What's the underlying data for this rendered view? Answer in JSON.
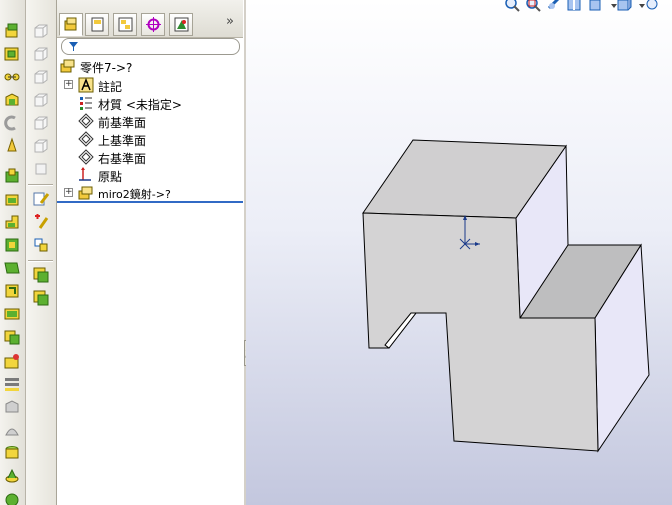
{
  "feature_manager": {
    "tabs": [
      "feature-manager-tab",
      "property-manager-tab",
      "configuration-manager-tab",
      "dimxpert-tab",
      "display-manager-tab"
    ],
    "expand_glyph": "»",
    "filter_icon": "filter-icon",
    "tree": [
      {
        "label": "零件7->?",
        "icon": "part-icon",
        "level": 0
      },
      {
        "label": "註記",
        "icon": "annotations-icon",
        "level": 1,
        "expandable": true
      },
      {
        "label": "材質 <未指定>",
        "icon": "material-icon",
        "level": 1
      },
      {
        "label": "前基準面",
        "icon": "plane-icon",
        "level": 1
      },
      {
        "label": "上基準面",
        "icon": "plane-icon",
        "level": 1
      },
      {
        "label": "右基準面",
        "icon": "plane-icon",
        "level": 1
      },
      {
        "label": "原點",
        "icon": "origin-icon",
        "level": 1
      },
      {
        "label": "miro2鏡射->?",
        "icon": "part-icon",
        "level": 1,
        "expandable": true
      }
    ]
  },
  "colors": {
    "accent": "#316ac5",
    "model_face": "#d4d3d4",
    "model_side": "#e8e7f8",
    "model_edge": "#000000",
    "viewport_top": "#ffffff",
    "viewport_bottom": "#c3c7de"
  }
}
